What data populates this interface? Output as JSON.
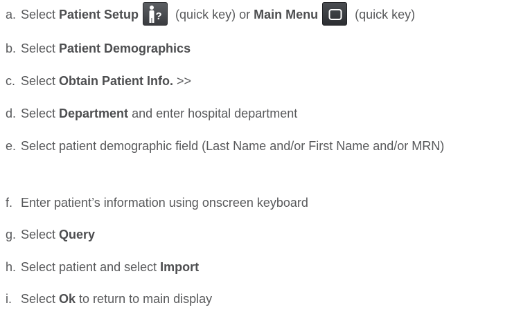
{
  "steps": [
    {
      "marker": "a.",
      "t1": "Select ",
      "b1": "Patient Setup",
      "t2": " (quick key) or ",
      "b2": "Main Menu",
      "t3": " (quick key)",
      "icon1": "patient-setup-quick-key-icon",
      "icon2": "main-menu-quick-key-icon"
    },
    {
      "marker": "b.",
      "t1": "Select ",
      "b1": "Patient Demographics"
    },
    {
      "marker": "c.",
      "t1": "Select ",
      "b1": "Obtain Patient Info.",
      "t2": " >>"
    },
    {
      "marker": "d.",
      "t1": "Select ",
      "b1": "Department",
      "t2": " and enter hospital department"
    },
    {
      "marker": "e.",
      "t1": "Select patient demographic field (Last Name and/or First Name and/or MRN)"
    },
    {
      "marker": "f.",
      "t1": "Enter patient’s information using onscreen keyboard"
    },
    {
      "marker": "g.",
      "t1": "Select ",
      "b1": "Query"
    },
    {
      "marker": "h.",
      "t1": "Select patient and select ",
      "b1": "Import"
    },
    {
      "marker": "i.",
      "t1": "Select ",
      "b1": "Ok",
      "t2": " to return to main display"
    }
  ],
  "colors": {
    "text": "#58595b",
    "bold": "#4d4e50",
    "key_background": "#3a3c40",
    "key_glyph": "#ffffff"
  }
}
